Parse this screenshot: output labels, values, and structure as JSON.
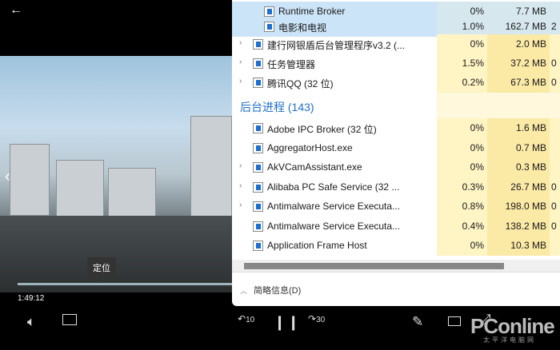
{
  "player": {
    "back_icon": "←",
    "tooltip": "定位",
    "time": "1:49:12",
    "progress": 0.42,
    "rewind_label": "10",
    "forward_label": "30"
  },
  "taskmgr": {
    "rows": [
      {
        "name": "Runtime Broker",
        "cpu": "0%",
        "mem": "7.7 MB",
        "x3": "",
        "expand": false,
        "selected": true,
        "indent": true
      },
      {
        "name": "电影和电视",
        "cpu": "1.0%",
        "mem": "162.7 MB",
        "x3": "2",
        "expand": false,
        "selected": true,
        "indent": true
      },
      {
        "name": "建行网银盾后台管理程序v3.2 (...",
        "cpu": "0%",
        "mem": "2.0 MB",
        "x3": "",
        "expand": true
      },
      {
        "name": "任务管理器",
        "cpu": "1.5%",
        "mem": "37.2 MB",
        "x3": "0",
        "expand": true
      },
      {
        "name": "腾讯QQ (32 位)",
        "cpu": "0.2%",
        "mem": "67.3 MB",
        "x3": "0",
        "expand": true
      }
    ],
    "bg_header": "后台进程 (143)",
    "bg_rows": [
      {
        "name": "Adobe IPC Broker (32 位)",
        "cpu": "0%",
        "mem": "1.6 MB",
        "x3": "",
        "expand": false
      },
      {
        "name": "AggregatorHost.exe",
        "cpu": "0%",
        "mem": "0.7 MB",
        "x3": "",
        "expand": false
      },
      {
        "name": "AkVCamAssistant.exe",
        "cpu": "0%",
        "mem": "0.3 MB",
        "x3": "",
        "expand": true
      },
      {
        "name": "Alibaba PC Safe Service (32 ...",
        "cpu": "0.3%",
        "mem": "26.7 MB",
        "x3": "0",
        "expand": true
      },
      {
        "name": "Antimalware Service Executa...",
        "cpu": "0.8%",
        "mem": "198.0 MB",
        "x3": "0",
        "expand": true
      },
      {
        "name": "Antimalware Service Executa...",
        "cpu": "0.4%",
        "mem": "138.2 MB",
        "x3": "0",
        "expand": false
      },
      {
        "name": "Application Frame Host",
        "cpu": "0%",
        "mem": "10.3 MB",
        "x3": "",
        "expand": false
      }
    ],
    "footer": "简略信息(D)"
  },
  "watermark": {
    "brand": "PConline",
    "sub": "太平洋电脑网"
  }
}
